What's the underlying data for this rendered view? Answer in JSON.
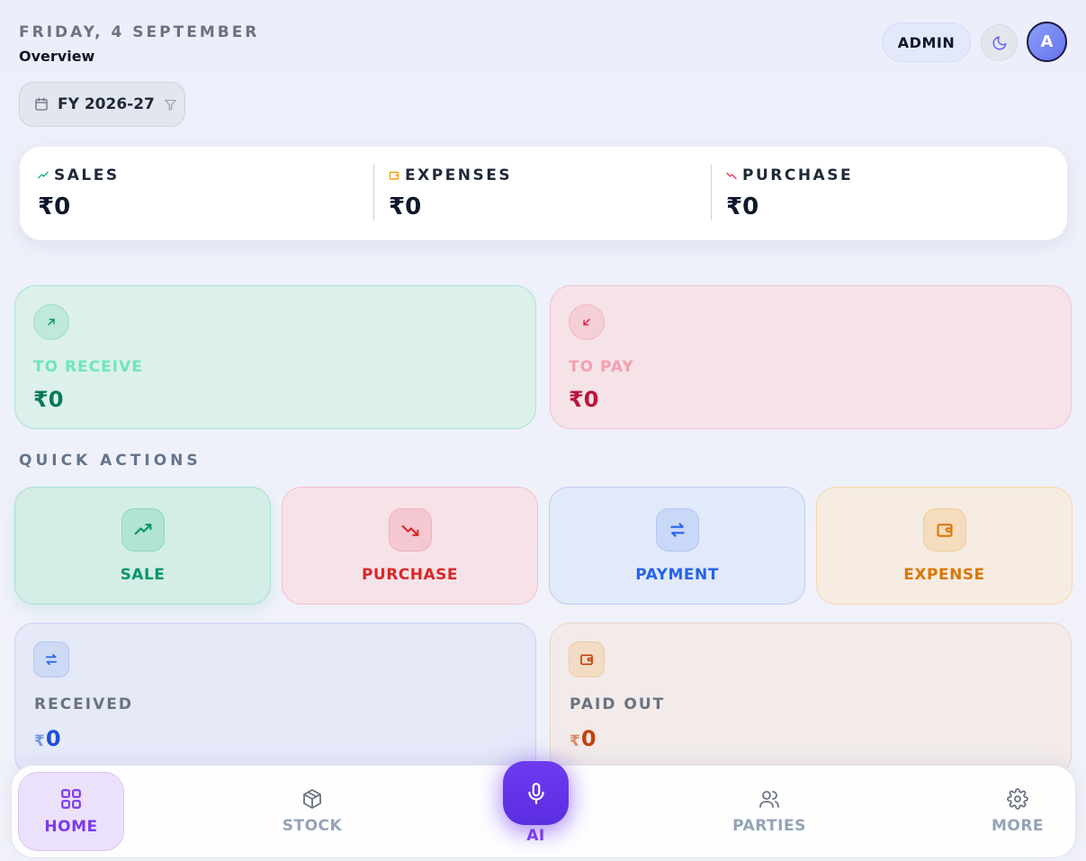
{
  "header": {
    "date": "FRIDAY, 4 SEPTEMBER",
    "subtitle": "Overview",
    "role_label": "ADMIN",
    "avatar_initial": "A",
    "theme_icon": "moon-icon"
  },
  "fiscal_filter": {
    "label": "FY 2026-27",
    "icons": [
      "calendar-icon",
      "filter-icon"
    ]
  },
  "summary": {
    "items": [
      {
        "label": "SALES",
        "value": "₹0",
        "icon": "trend-up-icon",
        "color": "#10b981"
      },
      {
        "label": "EXPENSES",
        "value": "₹0",
        "icon": "wallet-icon",
        "color": "#f59e0b"
      },
      {
        "label": "PURCHASE",
        "value": "₹0",
        "icon": "trend-down-icon",
        "color": "#f43f5e"
      }
    ]
  },
  "balances": {
    "receive": {
      "label": "TO RECEIVE",
      "value": "₹0",
      "icon": "arrow-up-right-icon",
      "color": "#10b981"
    },
    "pay": {
      "label": "TO PAY",
      "value": "₹0",
      "icon": "arrow-down-left-icon",
      "color": "#e11d48"
    }
  },
  "quick_actions": {
    "title": "QUICK ACTIONS",
    "items": [
      {
        "label": "SALE",
        "icon": "trend-up-icon",
        "color": "#059669"
      },
      {
        "label": "PURCHASE",
        "icon": "trend-down-icon",
        "color": "#dc2626"
      },
      {
        "label": "PAYMENT",
        "icon": "swap-arrows-icon",
        "color": "#2563eb"
      },
      {
        "label": "EXPENSE",
        "icon": "wallet-icon",
        "color": "#d97706"
      }
    ]
  },
  "cash_flow": {
    "received": {
      "label": "RECEIVED",
      "currency": "₹",
      "amount": "0",
      "icon": "swap-arrows-icon",
      "color": "#1d4ed8"
    },
    "paid_out": {
      "label": "PAID OUT",
      "currency": "₹",
      "amount": "0",
      "icon": "wallet-icon",
      "color": "#c2410c"
    }
  },
  "bottom_nav": {
    "items": [
      {
        "label": "HOME",
        "icon": "grid-icon",
        "active": true
      },
      {
        "label": "STOCK",
        "icon": "box-icon",
        "active": false
      },
      {
        "label": "AI",
        "icon": "microphone-icon",
        "active": false
      },
      {
        "label": "PARTIES",
        "icon": "users-icon",
        "active": false
      },
      {
        "label": "MORE",
        "icon": "gear-icon",
        "active": false
      }
    ]
  }
}
